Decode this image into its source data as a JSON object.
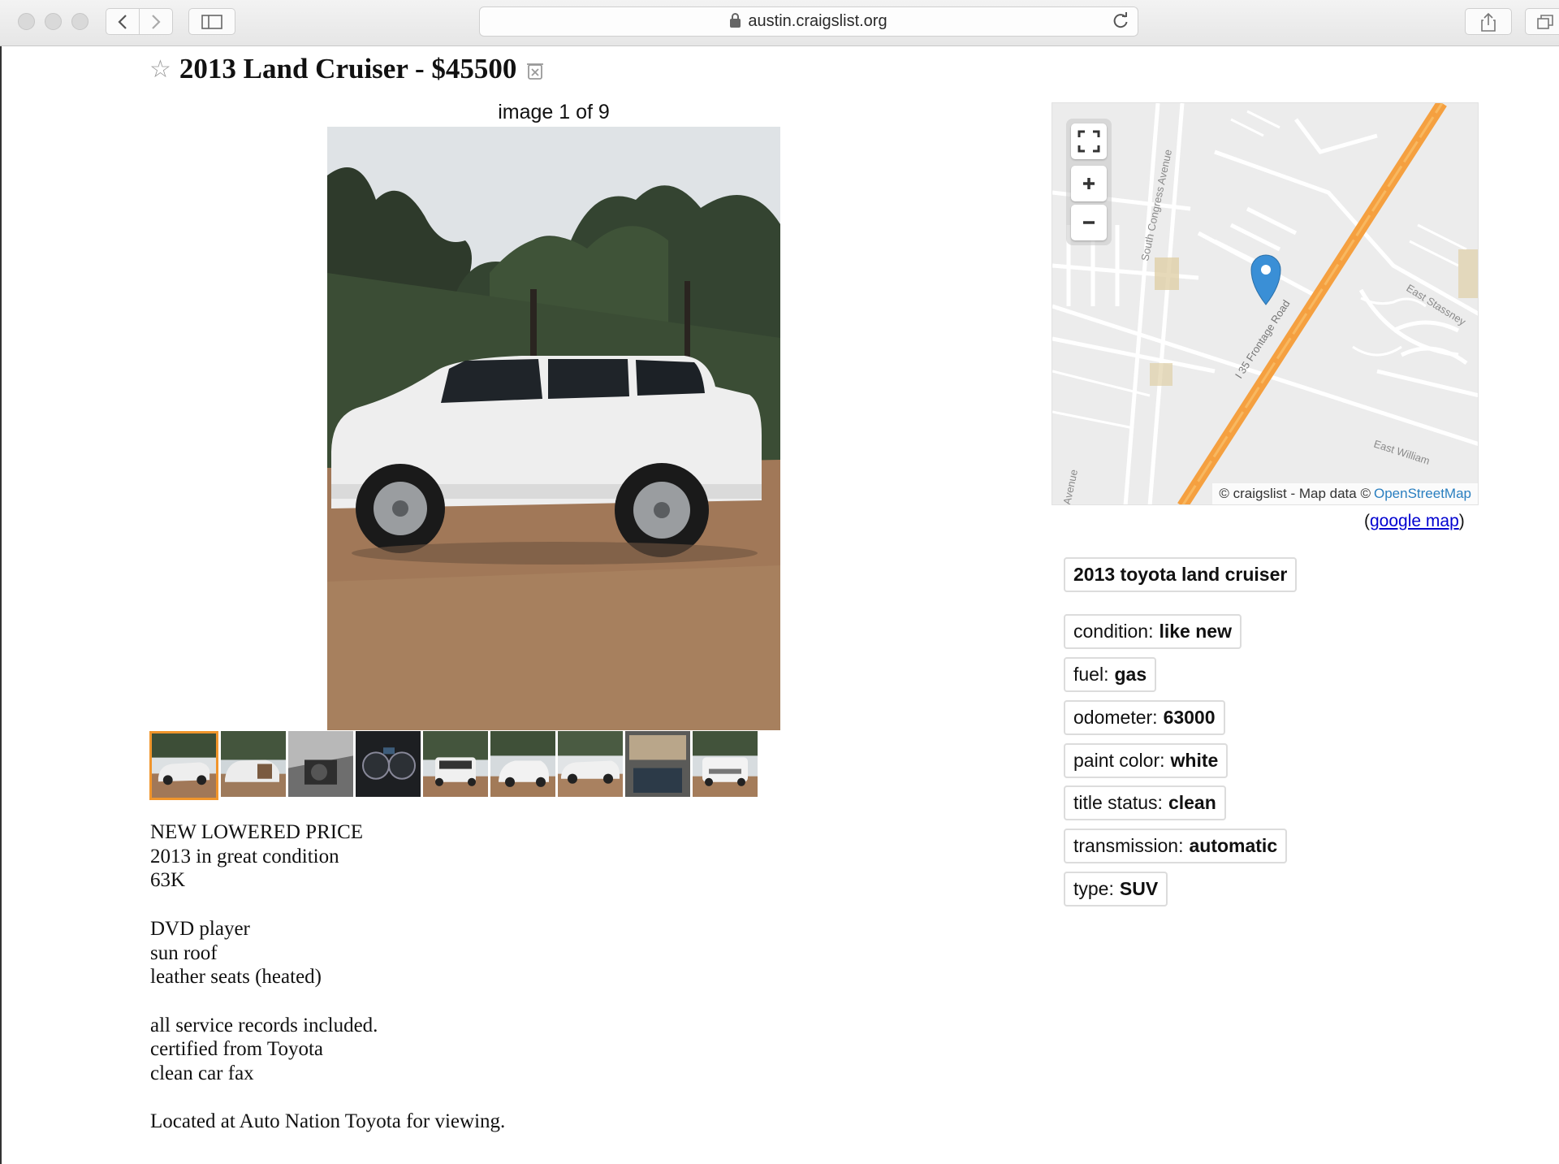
{
  "browser": {
    "url": "austin.craigslist.org"
  },
  "posting": {
    "title": "2013 Land Cruiser - $45500",
    "image_counter": "image 1 of 9",
    "body": [
      [
        "NEW LOWERED PRICE",
        "2013 in great condition",
        "63K"
      ],
      [
        "DVD player",
        "sun roof",
        "leather seats (heated)"
      ],
      [
        "all service records included.",
        "certified from Toyota",
        "clean car fax"
      ],
      [
        "Located at Auto Nation Toyota for viewing."
      ]
    ]
  },
  "map": {
    "attribution_prefix": "© craigslist - Map data ©",
    "attribution_link": "OpenStreetMap",
    "road_labels": [
      "South Congress Avenue",
      "I 35 Frontage Road",
      "East Stassney",
      "East William",
      "Avenue"
    ],
    "google_map_label": "google map",
    "open_paren": "(",
    "close_paren": ")"
  },
  "attributes": {
    "model": "2013 toyota land cruiser",
    "items": [
      {
        "label": "condition:",
        "value": "like new"
      },
      {
        "label": "fuel:",
        "value": "gas"
      },
      {
        "label": "odometer:",
        "value": "63000"
      },
      {
        "label": "paint color:",
        "value": "white"
      },
      {
        "label": "title status:",
        "value": "clean"
      },
      {
        "label": "transmission:",
        "value": "automatic"
      },
      {
        "label": "type:",
        "value": "SUV"
      }
    ]
  },
  "colors": {
    "accent_thumb_border": "#f0952c",
    "highway": "#f5a040",
    "map_pin": "#3a8fd6",
    "link": "#0000d0"
  },
  "icons": {
    "star": "favorite-star-icon",
    "hide": "hide-posting-icon",
    "fullscreen": "fullscreen-icon",
    "zoom_in": "zoom-in-icon",
    "zoom_out": "zoom-out-icon",
    "pin": "map-pin-icon"
  }
}
